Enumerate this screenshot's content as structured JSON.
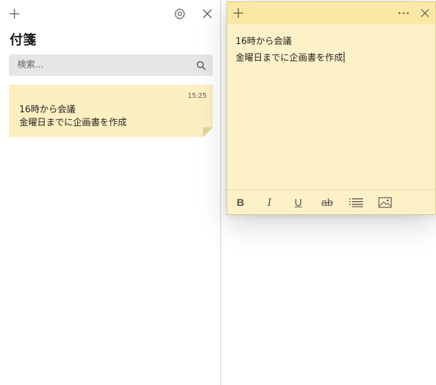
{
  "list_window": {
    "title": "付箋",
    "search": {
      "placeholder": "検索...",
      "value": ""
    },
    "notes": [
      {
        "time": "15:25",
        "lines": [
          "16時から会議",
          "金曜日までに企画書を作成"
        ]
      }
    ]
  },
  "note_window": {
    "lines": [
      "16時から会議",
      "金曜日までに企画書を作成"
    ],
    "toolbar": {
      "bold": "B",
      "italic": "I",
      "underline": "U",
      "strikethrough": "ab"
    }
  },
  "icons": {
    "list_add": "plus-icon",
    "list_settings": "gear-icon",
    "list_close": "close-icon",
    "search": "search-icon",
    "note_add": "plus-icon",
    "note_menu": "more-icon",
    "note_close": "close-icon",
    "bullets": "bullet-list-icon",
    "image": "image-icon"
  },
  "colors": {
    "note_background": "#fdf1c8",
    "note_titlebar": "#fbe8a4",
    "card_background": "#fcefc0",
    "search_background": "#e6e6e6"
  }
}
